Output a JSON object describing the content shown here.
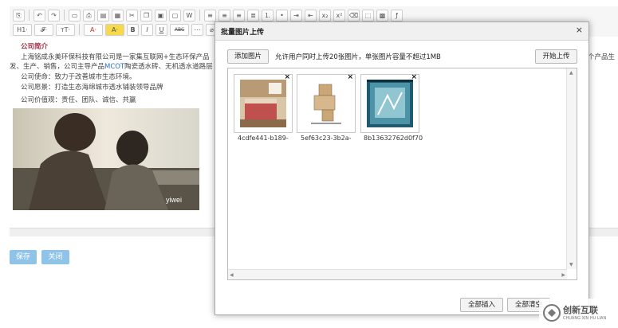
{
  "toolbar": {
    "row1_icons": [
      "source-icon",
      "undo-icon",
      "redo-icon",
      "new-doc-icon",
      "print-icon",
      "preview-icon",
      "template-icon",
      "cut-icon",
      "copy-icon",
      "paste-icon",
      "paste-plain-icon",
      "paste-word-icon",
      "align-left-icon",
      "align-center-icon",
      "align-right-icon",
      "align-justify-icon",
      "ordered-list-icon",
      "unordered-list-icon",
      "indent-icon",
      "outdent-icon",
      "subscript-icon",
      "superscript-icon",
      "clear-format-icon",
      "select-all-icon",
      "image-icon",
      "flash-icon"
    ],
    "row2_labels": [
      "H1·",
      "𝓕·",
      "тT·",
      "A·",
      "A·",
      "B",
      "I",
      "U",
      "ABC",
      "⋯"
    ]
  },
  "editor": {
    "heading": "公司简介",
    "line1": "上海铭成永美环保科技有限公司是一家集互联网+生态环保产品",
    "line1_tail": "个产品生",
    "line2": "发、生产、销售，公司主导产品",
    "line2_link": "MCOT",
    "line2_rest": "陶瓷透水砖、无机透水道路层",
    "line3": "公司使命：致力于改善城市生态环境。",
    "line4": "公司愿景：打造生态海绵城市透水铺装领导品牌",
    "line5": "公司价值观：责任、团队、诚信、共赢",
    "photo_caption": "yiwei"
  },
  "buttons": {
    "save": "保存",
    "close": "关闭"
  },
  "dialog": {
    "title": "批量图片上传",
    "close_glyph": "×",
    "add_image": "添加图片",
    "hint": "允许用户同时上传20张图片，单张图片容量不超过1MB",
    "start_upload": "开始上传",
    "insert_all": "全部插入",
    "clear_all": "全部清空",
    "files": [
      {
        "name": "4cdfe441-b189-",
        "remove": "×"
      },
      {
        "name": "5ef63c23-3b2a-",
        "remove": "×"
      },
      {
        "name": "8b13632762d0f70",
        "remove": "×"
      }
    ]
  },
  "watermark": {
    "brand": "创新互联",
    "sub": "CHUANG XIN HU LIAN"
  }
}
